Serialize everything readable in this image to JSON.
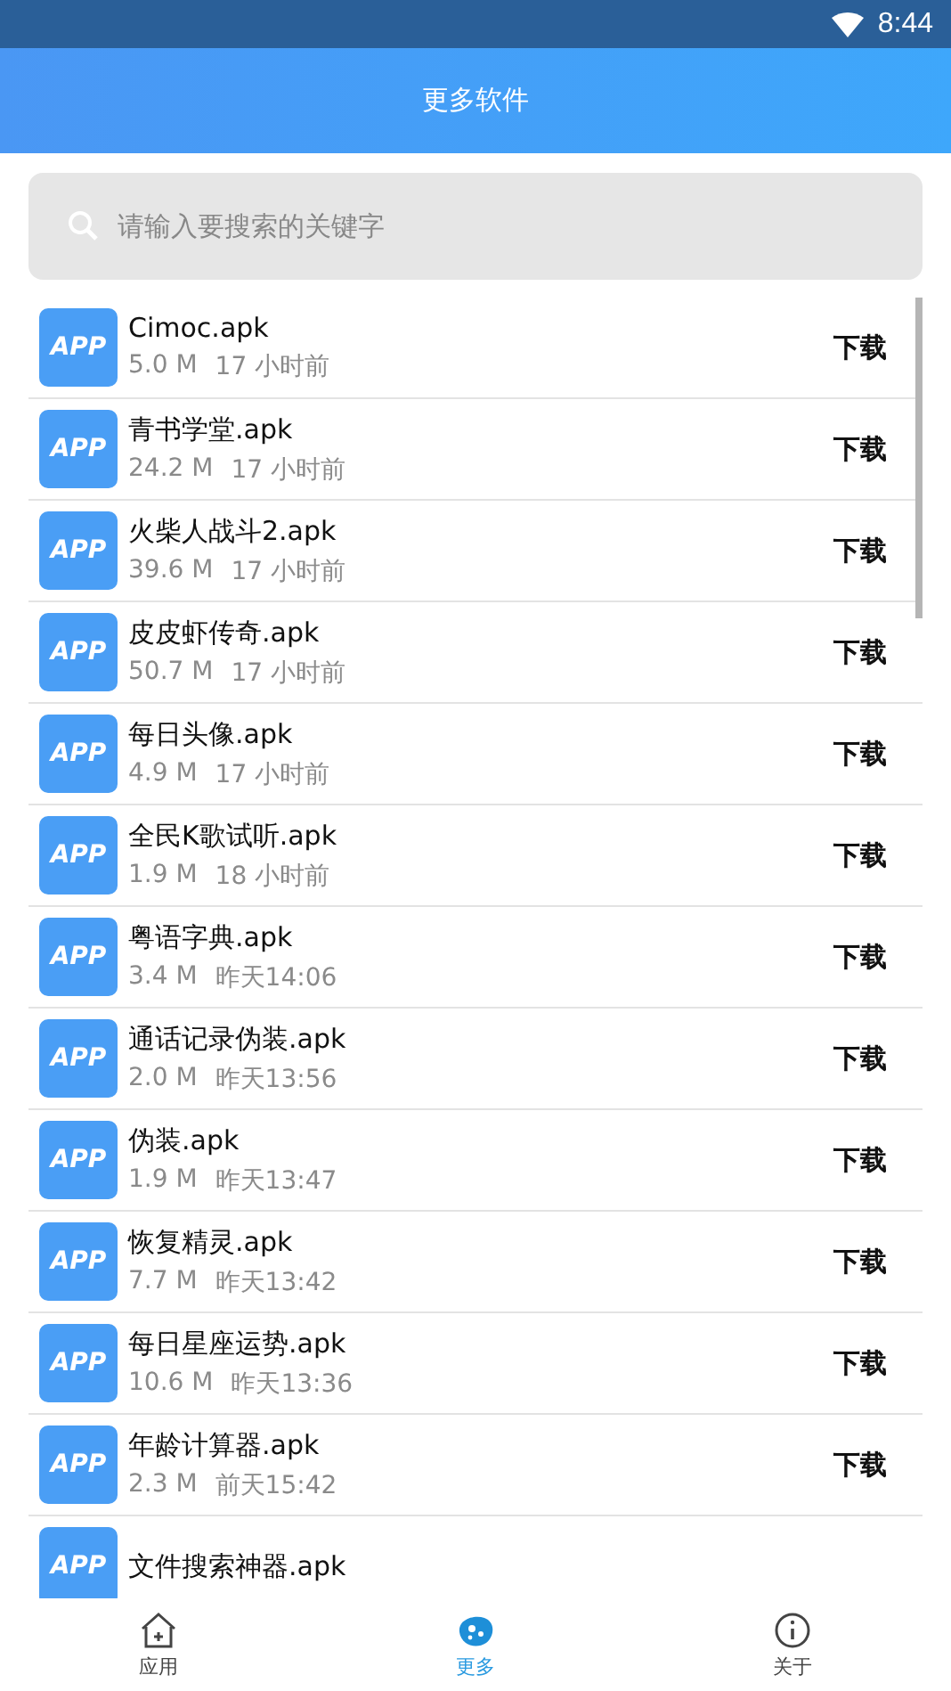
{
  "status_bar": {
    "time": "8:44"
  },
  "header": {
    "title": "更多软件"
  },
  "search": {
    "placeholder": "请输入要搜索的关键字"
  },
  "files": [
    {
      "icon_text": "APP",
      "name": "Cimoc.apk",
      "size": "5.0 M",
      "time": "17 小时前",
      "action": "下载"
    },
    {
      "icon_text": "APP",
      "name": "青书学堂.apk",
      "size": "24.2 M",
      "time": "17 小时前",
      "action": "下载"
    },
    {
      "icon_text": "APP",
      "name": "火柴人战斗2.apk",
      "size": "39.6 M",
      "time": "17 小时前",
      "action": "下载"
    },
    {
      "icon_text": "APP",
      "name": "皮皮虾传奇.apk",
      "size": "50.7 M",
      "time": "17 小时前",
      "action": "下载"
    },
    {
      "icon_text": "APP",
      "name": "每日头像.apk",
      "size": "4.9 M",
      "time": "17 小时前",
      "action": "下载"
    },
    {
      "icon_text": "APP",
      "name": "全民K歌试听.apk",
      "size": "1.9 M",
      "time": "18 小时前",
      "action": "下载"
    },
    {
      "icon_text": "APP",
      "name": "粤语字典.apk",
      "size": "3.4 M",
      "time": "昨天14:06",
      "action": "下载"
    },
    {
      "icon_text": "APP",
      "name": "通话记录伪装.apk",
      "size": "2.0 M",
      "time": "昨天13:56",
      "action": "下载"
    },
    {
      "icon_text": "APP",
      "name": "伪装.apk",
      "size": "1.9 M",
      "time": "昨天13:47",
      "action": "下载"
    },
    {
      "icon_text": "APP",
      "name": "恢复精灵.apk",
      "size": "7.7 M",
      "time": "昨天13:42",
      "action": "下载"
    },
    {
      "icon_text": "APP",
      "name": "每日星座运势.apk",
      "size": "10.6 M",
      "time": "昨天13:36",
      "action": "下载"
    },
    {
      "icon_text": "APP",
      "name": "年龄计算器.apk",
      "size": "2.3 M",
      "time": "前天15:42",
      "action": "下载"
    },
    {
      "icon_text": "APP",
      "name": "文件搜索神器.apk"
    }
  ],
  "bottom_nav": [
    {
      "kind": "home",
      "label": "应用",
      "selected": false
    },
    {
      "kind": "more",
      "label": "更多",
      "selected": true
    },
    {
      "kind": "about",
      "label": "关于",
      "selected": false
    }
  ]
}
